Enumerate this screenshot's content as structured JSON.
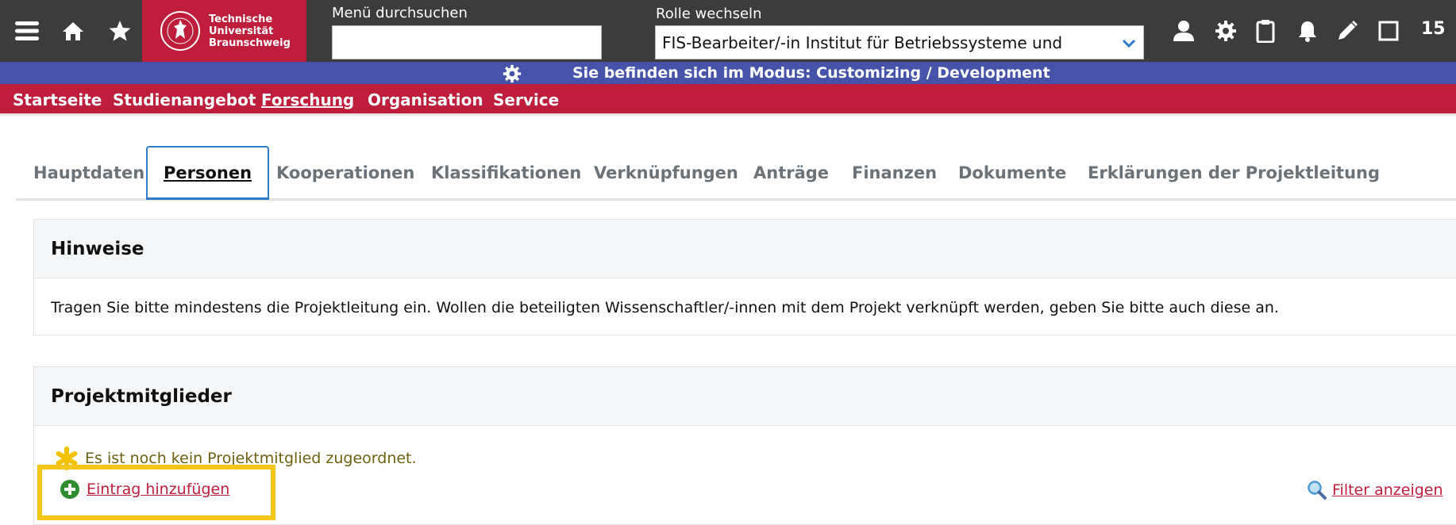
{
  "header": {
    "logo_line1": "Technische",
    "logo_line2": "Universität",
    "logo_line3": "Braunschweig",
    "search_label": "Menü durchsuchen",
    "search_value": "",
    "role_label": "Rolle wechseln",
    "role_value": "FIS-Bearbeiter/-in Institut für Betriebssysteme und",
    "counter": "15",
    "icons": [
      "menu-icon",
      "home-icon",
      "star-icon",
      "user-icon",
      "gear-icon",
      "clipboard-icon",
      "bell-icon",
      "pencil-icon",
      "window-icon"
    ]
  },
  "mode_bar": {
    "text": "Sie befinden sich im Modus: Customizing / Development"
  },
  "nav": {
    "items": [
      "Startseite",
      "Studienangebot",
      "Forschung",
      "Organisation",
      "Service"
    ],
    "active": "Forschung"
  },
  "tabs": {
    "items": [
      "Hauptdaten",
      "Personen",
      "Kooperationen",
      "Klassifikationen",
      "Verknüpfungen",
      "Anträge",
      "Finanzen",
      "Dokumente",
      "Erklärungen der Projektleitung"
    ],
    "active": "Personen"
  },
  "hints_panel": {
    "title": "Hinweise",
    "text": "Tragen Sie bitte mindestens die Projektleitung ein. Wollen die beteiligten Wissenschaftler/-innen mit dem Projekt verknüpft werden, geben Sie bitte auch diese an."
  },
  "members_panel": {
    "title": "Projektmitglieder",
    "empty_message": "Es ist noch kein Projektmitglied zugeordnet.",
    "add_label": "Eintrag hinzufügen",
    "filter_label": "Filter anzeigen"
  },
  "colors": {
    "topbar": "#3c3c3c",
    "brand_red": "#be1e3c",
    "mode_blue": "#4653a8",
    "tab_active_border": "#2e7cc9",
    "highlight": "#f5c518"
  }
}
